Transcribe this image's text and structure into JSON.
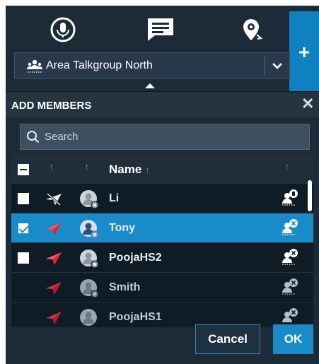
{
  "top_icons": [
    "microphone-icon",
    "message-icon",
    "location-pin-icon"
  ],
  "add_button_label": "+",
  "talkgroup": {
    "selected": "Area Talkgroup North"
  },
  "panel": {
    "title": "ADD MEMBERS",
    "close_label": "✕",
    "search_placeholder": "Search"
  },
  "table": {
    "headers": {
      "name": "Name"
    },
    "rows": [
      {
        "name": "Li",
        "checked": false,
        "status": "offline",
        "selected": false
      },
      {
        "name": "Tony",
        "checked": true,
        "status": "online",
        "selected": true
      },
      {
        "name": "PoojaHS2",
        "checked": false,
        "status": "online",
        "selected": false
      },
      {
        "name": "Smith",
        "checked": false,
        "status": "online",
        "selected": false
      },
      {
        "name": "PoojaHS1",
        "checked": false,
        "status": "online",
        "selected": false
      }
    ]
  },
  "footer": {
    "cancel_label": "Cancel",
    "ok_label": "OK"
  },
  "colors": {
    "accent": "#1a8bc9",
    "status_active": "#e0243a",
    "background": "#1c2b37"
  }
}
